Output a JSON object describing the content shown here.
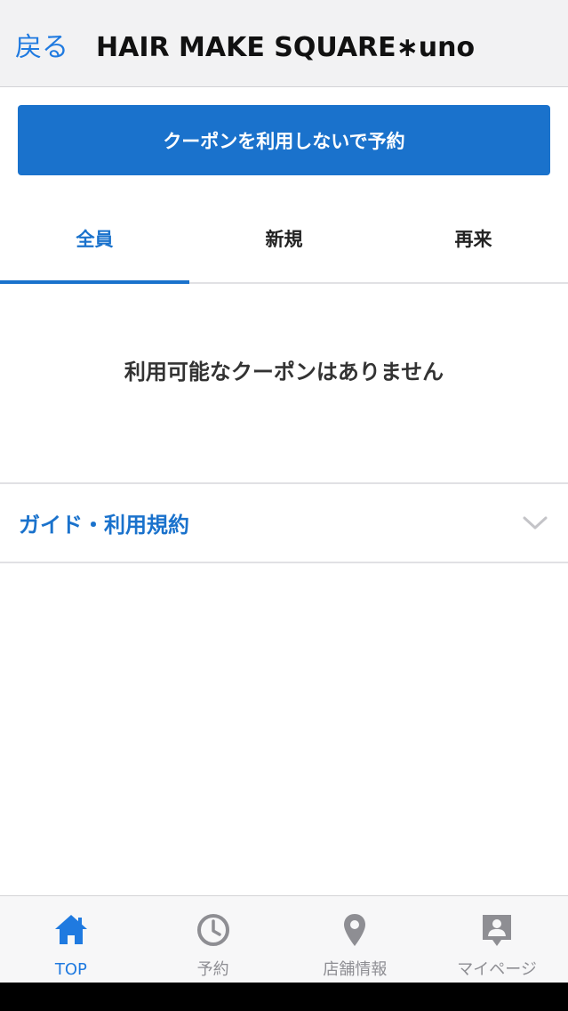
{
  "nav": {
    "back_label": "戻る",
    "title": "HAIR MAKE SQUARE∗uno"
  },
  "primary_button": {
    "label": "クーポンを利用しないで予約"
  },
  "tabs": [
    {
      "label": "全員",
      "active": true
    },
    {
      "label": "新規",
      "active": false
    },
    {
      "label": "再来",
      "active": false
    }
  ],
  "empty_message": "利用可能なクーポンはありません",
  "guide": {
    "label": "ガイド・利用規約",
    "icon": "chevron-down-icon"
  },
  "tabbar": {
    "items": [
      {
        "label": "TOP",
        "icon": "home-icon",
        "active": true
      },
      {
        "label": "予約",
        "icon": "clock-icon",
        "active": false
      },
      {
        "label": "店舗情報",
        "icon": "location-pin-icon",
        "active": false
      },
      {
        "label": "マイページ",
        "icon": "profile-icon",
        "active": false
      }
    ]
  },
  "colors": {
    "accent": "#1a72cc",
    "nav_link": "#1f7ae0",
    "inactive": "#8e8e93"
  }
}
